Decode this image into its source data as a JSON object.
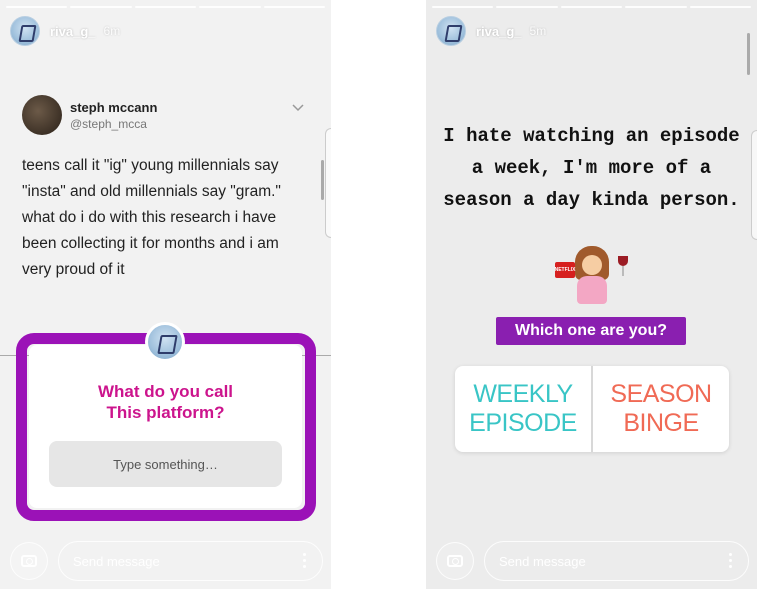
{
  "left_story": {
    "username": "riva_g_",
    "time": "6m",
    "tweet": {
      "name": "steph mccann",
      "handle": "@steph_mcca",
      "text": "teens call it \"ig\" young millennials say \"insta\" and old millennials say \"gram.\" what do i do with this research i have been collecting it for months and i am very proud of it"
    },
    "question": {
      "title_line1": "What do you call",
      "title_line2": "This platform?",
      "placeholder": "Type something…"
    },
    "send_placeholder": "Send message"
  },
  "right_story": {
    "username": "riva_g_",
    "time": "5m",
    "caption": "I hate watching an episode a week, I'm more of a season a day kinda person.",
    "emoji_box_label": "NETFLIX",
    "poll_question": "Which one are you?",
    "poll_options": [
      "WEEKLY\nEPISODE",
      "SEASON\nBINGE"
    ],
    "send_placeholder": "Send message"
  },
  "colors": {
    "question_frame": "#9b12b7",
    "question_text": "#cc148d",
    "poll_question_bg": "#8a1fb0",
    "poll_left": "#39c5c6",
    "poll_right": "#f06a55"
  },
  "icons": {
    "camera": "camera-icon",
    "more": "more-vertical-icon",
    "chevron": "chevron-down-icon"
  }
}
